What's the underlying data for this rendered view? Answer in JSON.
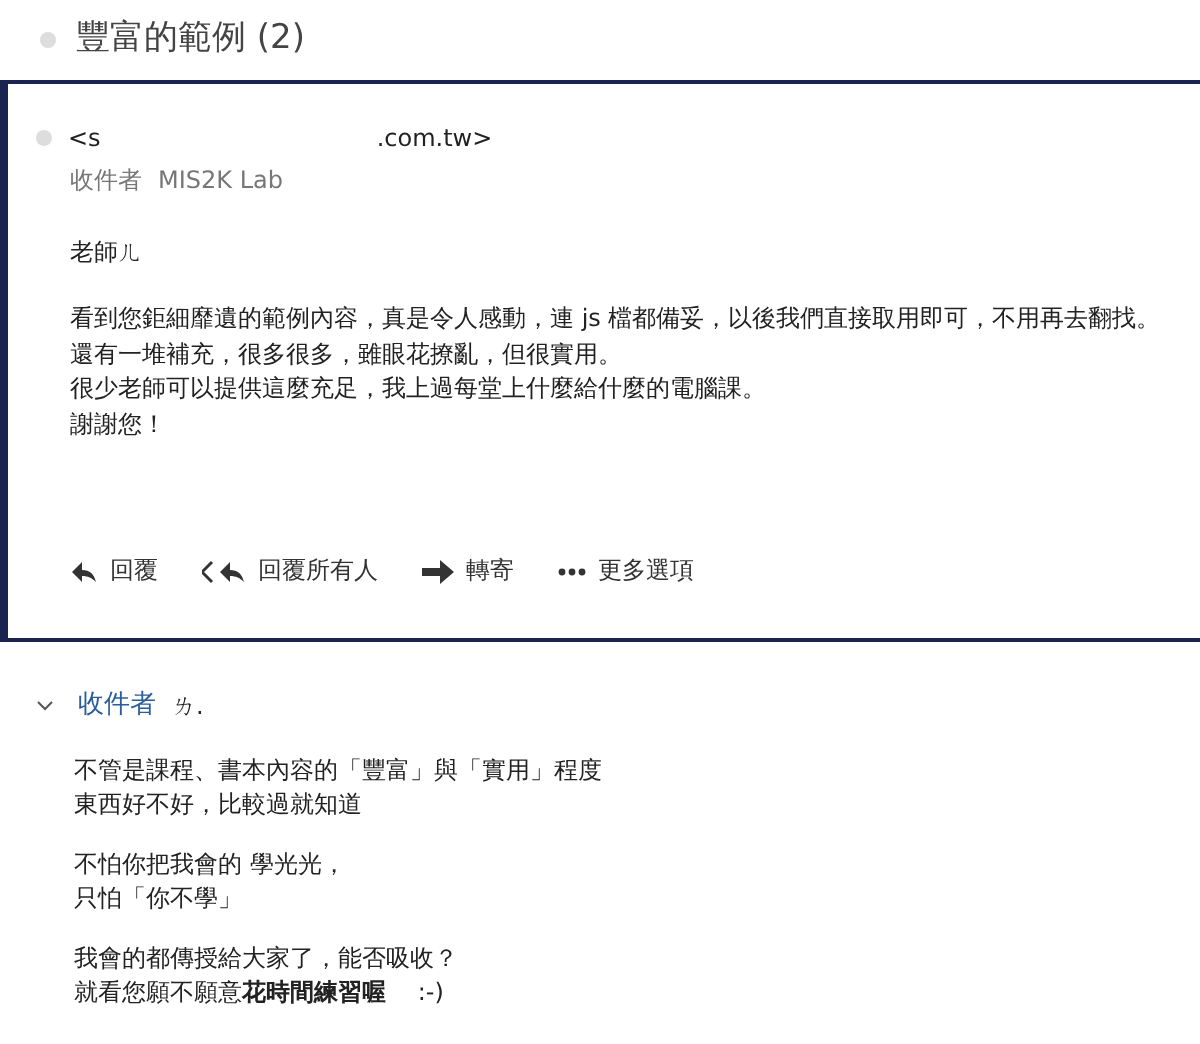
{
  "thread": {
    "title": "豐富的範例 (2)"
  },
  "message_1": {
    "sender_name": "<s",
    "sender_domain": ".com.tw>",
    "to_label": "收件者",
    "to_name": "MIS2K Lab",
    "greeting": "老師ㄦ",
    "body": [
      "看到您鉅細靡遺的範例內容，真是令人感動，連 js 檔都備妥，以後我們直接取用即可，不用再去翻找。",
      "還有一堆補充，很多很多，雖眼花撩亂，但很實用。",
      "很少老師可以提供這麼充足，我上過每堂上什麼給什麼的電腦課。",
      "謝謝您！"
    ],
    "actions": [
      {
        "kind": "reply",
        "label": "回覆"
      },
      {
        "kind": "reply_all",
        "label": "回覆所有人"
      },
      {
        "kind": "forward",
        "label": "轉寄"
      },
      {
        "kind": "more",
        "label": "更多選項"
      }
    ]
  },
  "message_2": {
    "to_label": "收件者",
    "to_name": "ㄌ.",
    "paragraphs": [
      [
        "不管是課程、書本內容的「豐富」與「實用」程度",
        "東西好不好，比較過就知道"
      ],
      [
        "不怕你把我會的  學光光，",
        "只怕「你不學」"
      ],
      [
        "我會的都傳授給大家了，能否吸收？",
        "就看您願不願意**花時間練習喔**　 :-)"
      ]
    ]
  }
}
